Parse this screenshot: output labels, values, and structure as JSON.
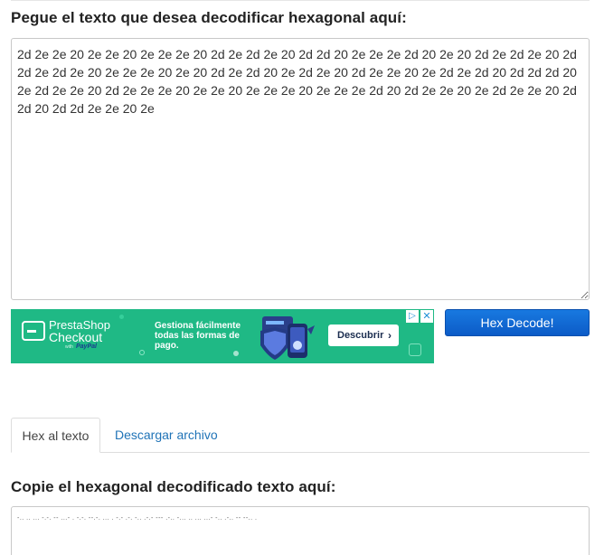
{
  "input_section": {
    "heading": "Pegue el texto que desea decodificar hexagonal aquí:",
    "hex_value": "2d 2e 2e 20 2e 2e 20 2e 2e 2e 20 2d 2e 2d 2e 20 2d 2d 20 2e 2e 2e 2d 20 2e 20 2d 2e 2d 2e 20 2d 2d 2e 2d 2e 20 2e 2e 2e 20 2e 20 2d 2e 2d 20 2e 2d 2e 20 2d 2e 2e 20 2e 2d 2e 2d 20 2d 2d 2d 20 2e 2d 2e 2e 20 2d 2e 2e 2e 20 2e 2e 20 2e 2e 2e 20 2e 2e 2e 2d 20 2d 2e 2e 20 2e 2d 2e 2e 20 2d 2d 20 2d 2d 2e 2e 20 2e"
  },
  "ad_banner": {
    "brand": "PrestaShop",
    "brand_sub": "Checkout",
    "with_text": "with",
    "partner": "PayPal",
    "message": "Gestiona fácilmente todas las formas de pago.",
    "cta_label": "Descubrir",
    "cta_chevron": "›",
    "adchoices_icon": "▷",
    "close_icon": "✕",
    "color_bg": "#1fb985"
  },
  "decode_button": {
    "label": "Hex Decode!",
    "color": "#1170d8"
  },
  "tabs": [
    {
      "label": "Hex al texto",
      "active": true
    },
    {
      "label": "Descargar archivo",
      "active": false
    }
  ],
  "output_section": {
    "heading": "Copie el hexagonal decodificado texto aquí:",
    "decoded_value": "-.. .. ... -.-. -- ...- . -.-. --.-. ... . -.- .-. -.. .-.- --- .-.. -... .. ... ...- -.. .-.. -- --.. ."
  }
}
